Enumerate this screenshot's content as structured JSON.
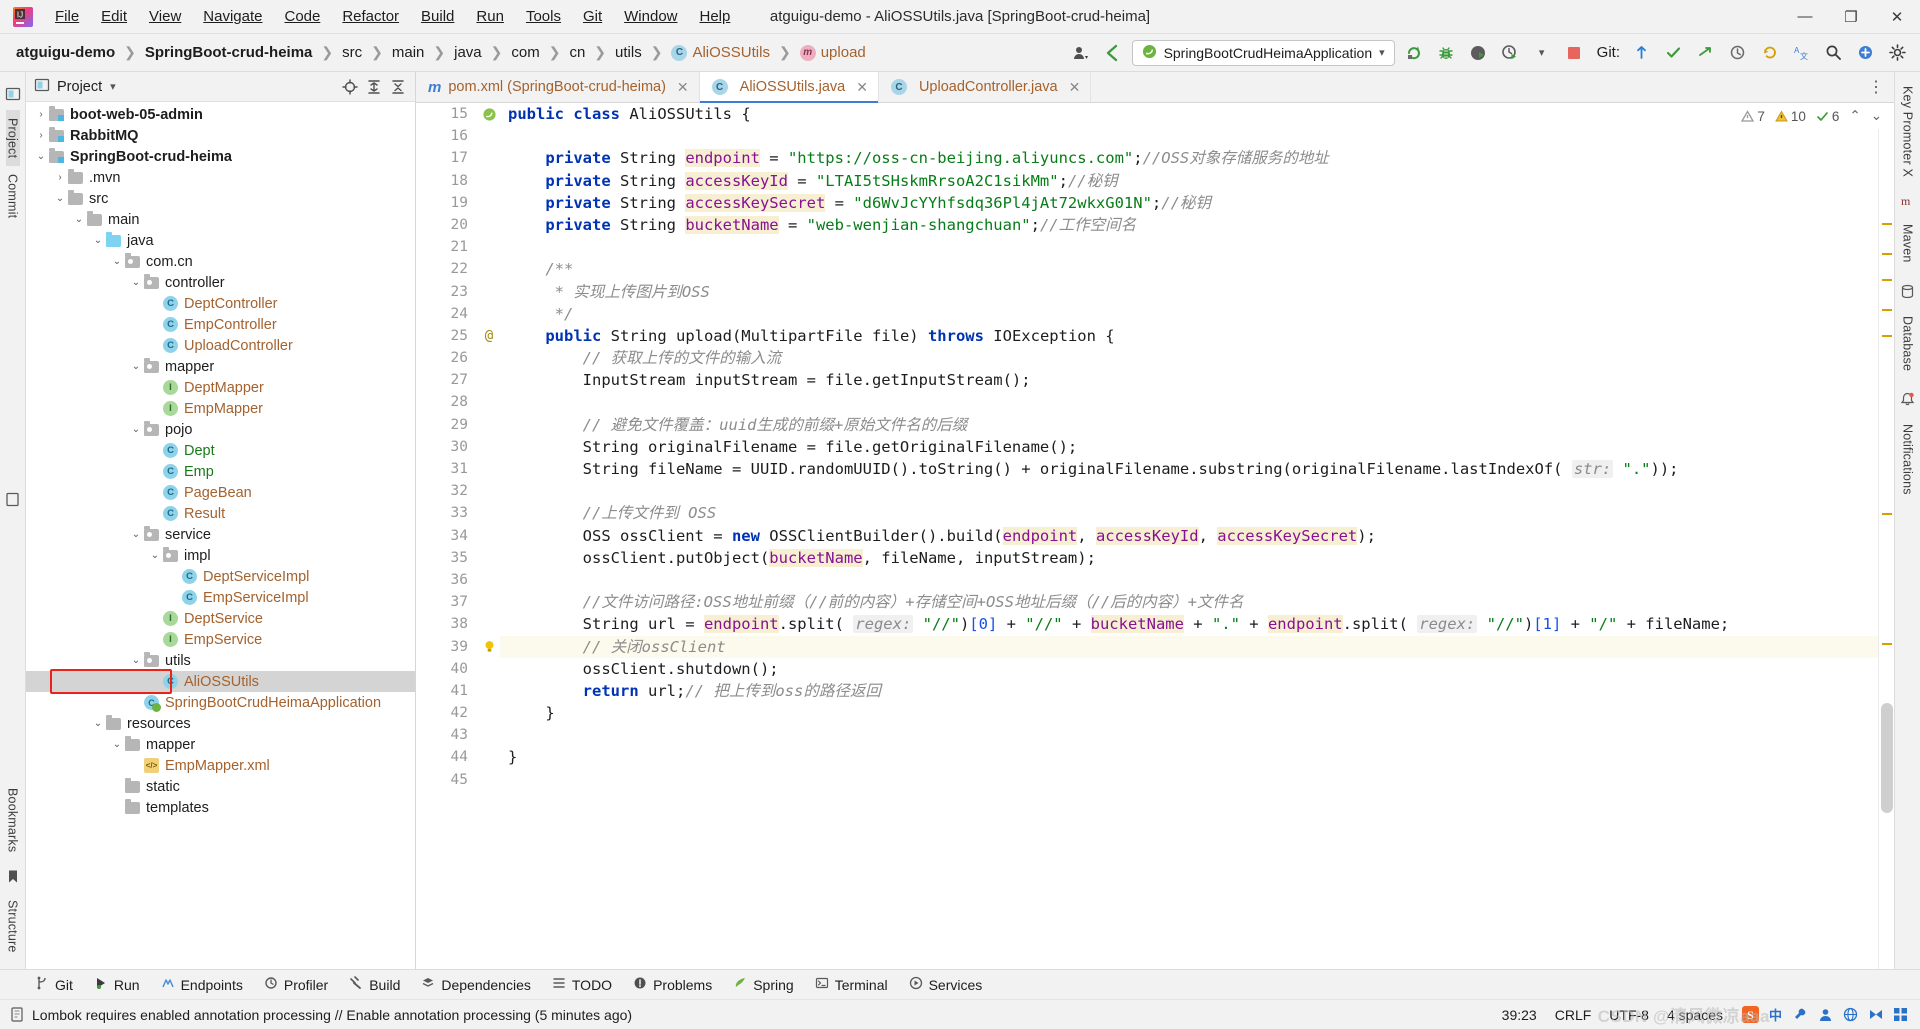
{
  "window": {
    "title": "atguigu-demo - AliOSSUtils.java [SpringBoot-crud-heima]",
    "minimize": "—",
    "maximize": "❐",
    "close": "✕"
  },
  "menu": [
    {
      "label": "File"
    },
    {
      "label": "Edit"
    },
    {
      "label": "View"
    },
    {
      "label": "Navigate"
    },
    {
      "label": "Code"
    },
    {
      "label": "Refactor"
    },
    {
      "label": "Build"
    },
    {
      "label": "Run"
    },
    {
      "label": "Tools"
    },
    {
      "label": "Git"
    },
    {
      "label": "Window"
    },
    {
      "label": "Help"
    }
  ],
  "breadcrumbs": [
    {
      "label": "atguigu-demo",
      "style": "bold"
    },
    {
      "label": "SpringBoot-crud-heima",
      "style": "bold"
    },
    {
      "label": "src",
      "style": "plain"
    },
    {
      "label": "main",
      "style": "plain"
    },
    {
      "label": "java",
      "style": "plain"
    },
    {
      "label": "com",
      "style": "plain"
    },
    {
      "label": "cn",
      "style": "plain"
    },
    {
      "label": "utils",
      "style": "plain"
    },
    {
      "label": "AliOSSUtils",
      "style": "class",
      "icon": "class-c-icon"
    },
    {
      "label": "upload",
      "style": "method",
      "icon": "method-m-icon"
    }
  ],
  "toolbar": {
    "run_config": "SpringBootCrudHeimaApplication",
    "run_config_icon": "spring-boot-icon",
    "dropdown_arrow": "▾",
    "icons": {
      "user_avatar": "user-avatar-icon",
      "back_arrow": "back-arrow-icon",
      "rerun": "rerun-icon",
      "debug": "debug-bug-icon",
      "coverage": "run-with-coverage-icon",
      "profiler": "profiler-icon",
      "stop": "stop-icon",
      "git_update": "git-update-icon",
      "git_commit": "git-commit-icon",
      "git_push": "git-push-icon",
      "git_history": "git-history-icon",
      "git_rollback": "git-rollback-icon",
      "translate": "translate-icon",
      "search": "search-icon",
      "plugins": "plugins-icon",
      "settings": "settings-gear-icon"
    },
    "git_label": "Git:"
  },
  "left_rail": [
    {
      "label": "Project",
      "selected": true
    },
    {
      "label": "Commit",
      "selected": false
    },
    {
      "label": "Bookmarks",
      "selected": false
    },
    {
      "label": "Structure",
      "selected": false
    }
  ],
  "right_rail": [
    {
      "label": "Key Promoter X"
    },
    {
      "label": "Maven"
    },
    {
      "label": "Database"
    },
    {
      "label": "Notifications"
    }
  ],
  "project_panel": {
    "title": "Project",
    "dropdown": "▾",
    "icons": {
      "locate": "locate-file-icon",
      "expand": "expand-all-icon",
      "collapse": "collapse-all-icon",
      "settings": "panel-settings-icon",
      "hide": "hide-panel-icon"
    },
    "tree": [
      {
        "indent": 1,
        "arrow": "collapsed",
        "icon": "module-folder",
        "label": "boot-web-05-admin",
        "style": "bold"
      },
      {
        "indent": 1,
        "arrow": "collapsed",
        "icon": "module-folder",
        "label": "RabbitMQ",
        "style": "bold"
      },
      {
        "indent": 1,
        "arrow": "expanded",
        "icon": "module-folder",
        "label": "SpringBoot-crud-heima",
        "style": "bold"
      },
      {
        "indent": 2,
        "arrow": "collapsed",
        "icon": "folder",
        "label": ".mvn",
        "style": "plain"
      },
      {
        "indent": 2,
        "arrow": "expanded",
        "icon": "folder",
        "label": "src",
        "style": "plain"
      },
      {
        "indent": 3,
        "arrow": "expanded",
        "icon": "folder",
        "label": "main",
        "style": "plain"
      },
      {
        "indent": 4,
        "arrow": "expanded",
        "icon": "source-folder",
        "label": "java",
        "style": "plain"
      },
      {
        "indent": 5,
        "arrow": "expanded",
        "icon": "package",
        "label": "com.cn",
        "style": "plain"
      },
      {
        "indent": 6,
        "arrow": "expanded",
        "icon": "package",
        "label": "controller",
        "style": "plain"
      },
      {
        "indent": 7,
        "arrow": "none",
        "icon": "class",
        "label": "DeptController",
        "style": "class"
      },
      {
        "indent": 7,
        "arrow": "none",
        "icon": "class",
        "label": "EmpController",
        "style": "class"
      },
      {
        "indent": 7,
        "arrow": "none",
        "icon": "class",
        "label": "UploadController",
        "style": "class"
      },
      {
        "indent": 6,
        "arrow": "expanded",
        "icon": "package",
        "label": "mapper",
        "style": "plain"
      },
      {
        "indent": 7,
        "arrow": "none",
        "icon": "interface",
        "label": "DeptMapper",
        "style": "class"
      },
      {
        "indent": 7,
        "arrow": "none",
        "icon": "interface",
        "label": "EmpMapper",
        "style": "class"
      },
      {
        "indent": 6,
        "arrow": "expanded",
        "icon": "package",
        "label": "pojo",
        "style": "plain"
      },
      {
        "indent": 7,
        "arrow": "none",
        "icon": "class",
        "label": "Dept",
        "style": "green"
      },
      {
        "indent": 7,
        "arrow": "none",
        "icon": "class",
        "label": "Emp",
        "style": "green"
      },
      {
        "indent": 7,
        "arrow": "none",
        "icon": "class",
        "label": "PageBean",
        "style": "class"
      },
      {
        "indent": 7,
        "arrow": "none",
        "icon": "class",
        "label": "Result",
        "style": "class"
      },
      {
        "indent": 6,
        "arrow": "expanded",
        "icon": "package",
        "label": "service",
        "style": "plain"
      },
      {
        "indent": 7,
        "arrow": "expanded",
        "icon": "package",
        "label": "impl",
        "style": "plain"
      },
      {
        "indent": 8,
        "arrow": "none",
        "icon": "class",
        "label": "DeptServiceImpl",
        "style": "class"
      },
      {
        "indent": 8,
        "arrow": "none",
        "icon": "class",
        "label": "EmpServiceImpl",
        "style": "class"
      },
      {
        "indent": 7,
        "arrow": "none",
        "icon": "interface",
        "label": "DeptService",
        "style": "class"
      },
      {
        "indent": 7,
        "arrow": "none",
        "icon": "interface",
        "label": "EmpService",
        "style": "class"
      },
      {
        "indent": 6,
        "arrow": "expanded",
        "icon": "package",
        "label": "utils",
        "style": "plain"
      },
      {
        "indent": 7,
        "arrow": "none",
        "icon": "class",
        "label": "AliOSSUtils",
        "style": "class",
        "selected": true,
        "highlight": true
      },
      {
        "indent": 6,
        "arrow": "none",
        "icon": "spring-class",
        "label": "SpringBootCrudHeimaApplication",
        "style": "class"
      },
      {
        "indent": 4,
        "arrow": "expanded",
        "icon": "resource-folder",
        "label": "resources",
        "style": "plain"
      },
      {
        "indent": 5,
        "arrow": "expanded",
        "icon": "folder",
        "label": "mapper",
        "style": "plain"
      },
      {
        "indent": 6,
        "arrow": "none",
        "icon": "xml",
        "label": "EmpMapper.xml",
        "style": "class"
      },
      {
        "indent": 5,
        "arrow": "none",
        "icon": "folder",
        "label": "static",
        "style": "plain"
      },
      {
        "indent": 5,
        "arrow": "none",
        "icon": "folder",
        "label": "templates",
        "style": "plain"
      }
    ]
  },
  "editor": {
    "tabs": [
      {
        "label": "pom.xml (SpringBoot-crud-heima)",
        "icon": "maven-m-icon",
        "active": false,
        "close": "✕"
      },
      {
        "label": "AliOSSUtils.java",
        "icon": "class-c-icon",
        "active": true,
        "close": "✕"
      },
      {
        "label": "UploadController.java",
        "icon": "class-c-icon",
        "active": false,
        "close": "✕"
      }
    ],
    "inspections": {
      "warnings_gray": "7",
      "warnings_yellow": "10",
      "weak_green": "6",
      "chevron_up": "⌃",
      "chevron_down": "⌄"
    },
    "first_line_number": 15,
    "lines": [
      {
        "n": 15,
        "text": "public class AliOSSUtils {",
        "gutter": "spring-bean-icon"
      },
      {
        "n": 16,
        "text": ""
      },
      {
        "n": 17,
        "text": "    private String endpoint = \"https://oss-cn-beijing.aliyuncs.com\";//OSS对象存储服务的地址"
      },
      {
        "n": 18,
        "text": "    private String accessKeyId = \"LTAI5tSHskmRrsoA2C1sikMm\";//秘钥"
      },
      {
        "n": 19,
        "text": "    private String accessKeySecret = \"d6WvJcYYhfsdq36Pl4jAt72wkxG01N\";//秘钥"
      },
      {
        "n": 20,
        "text": "    private String bucketName = \"web-wenjian-shangchuan\";//工作空间名"
      },
      {
        "n": 21,
        "text": ""
      },
      {
        "n": 22,
        "text": "    /**"
      },
      {
        "n": 23,
        "text": "     * 实现上传图片到OSS"
      },
      {
        "n": 24,
        "text": "     */"
      },
      {
        "n": 25,
        "text": "    public String upload(MultipartFile file) throws IOException {",
        "gutter": "override-at-icon"
      },
      {
        "n": 26,
        "text": "        // 获取上传的文件的输入流"
      },
      {
        "n": 27,
        "text": "        InputStream inputStream = file.getInputStream();"
      },
      {
        "n": 28,
        "text": ""
      },
      {
        "n": 29,
        "text": "        // 避免文件覆盖：uuid生成的前缀+原始文件名的后缀"
      },
      {
        "n": 30,
        "text": "        String originalFilename = file.getOriginalFilename();"
      },
      {
        "n": 31,
        "text": "        String fileName = UUID.randomUUID().toString() + originalFilename.substring(originalFilename.lastIndexOf( str: \".\"));"
      },
      {
        "n": 32,
        "text": ""
      },
      {
        "n": 33,
        "text": "        //上传文件到 OSS"
      },
      {
        "n": 34,
        "text": "        OSS ossClient = new OSSClientBuilder().build(endpoint, accessKeyId, accessKeySecret);"
      },
      {
        "n": 35,
        "text": "        ossClient.putObject(bucketName, fileName, inputStream);"
      },
      {
        "n": 36,
        "text": ""
      },
      {
        "n": 37,
        "text": "        //文件访问路径:OSS地址前缀（//前的内容）+存储空间+OSS地址后缀（//后的内容）+文件名"
      },
      {
        "n": 38,
        "text": "        String url = endpoint.split( regex: \"//\")[0] + \"//\" + bucketName + \".\" + endpoint.split( regex: \"//\")[1] + \"/\" + fileName;"
      },
      {
        "n": 39,
        "text": "        // 关闭ossClient",
        "gutter": "bulb-icon",
        "highlight": true
      },
      {
        "n": 40,
        "text": "        ossClient.shutdown();"
      },
      {
        "n": 41,
        "text": "        return url;// 把上传到oss的路径返回"
      },
      {
        "n": 42,
        "text": "    }"
      },
      {
        "n": 43,
        "text": ""
      },
      {
        "n": 44,
        "text": "}"
      },
      {
        "n": 45,
        "text": ""
      }
    ]
  },
  "tool_windows": [
    {
      "label": "Git",
      "icon": "git-branch-icon"
    },
    {
      "label": "Run",
      "icon": "run-play-icon"
    },
    {
      "label": "Endpoints",
      "icon": "endpoints-icon"
    },
    {
      "label": "Profiler",
      "icon": "profiler-icon"
    },
    {
      "label": "Build",
      "icon": "build-hammer-icon"
    },
    {
      "label": "Dependencies",
      "icon": "dependencies-icon"
    },
    {
      "label": "TODO",
      "icon": "todo-list-icon"
    },
    {
      "label": "Problems",
      "icon": "problems-icon"
    },
    {
      "label": "Spring",
      "icon": "spring-leaf-icon"
    },
    {
      "label": "Terminal",
      "icon": "terminal-icon"
    },
    {
      "label": "Services",
      "icon": "services-icon"
    }
  ],
  "status_bar": {
    "message_icon": "event-log-icon",
    "message": "Lombok requires enabled annotation processing // Enable annotation processing (5 minutes ago)",
    "caret_position": "39:23",
    "line_separator": "CRLF",
    "encoding": "UTF-8",
    "indent": "4 spaces",
    "tray_icons": [
      "sogou-input-icon",
      "ime-chinese-icon",
      "ime-tool-icon",
      "user-icon",
      "globe-icon",
      "bow-icon",
      "apps-icon"
    ],
    "watermark": "CSDN @清风微凉aaa"
  },
  "colors": {
    "accent_blue": "#3d7dd2",
    "selection_gray": "#d4d4d4",
    "highlight_red": "#e8231a",
    "string_green": "#067d17",
    "keyword_blue": "#0033b3",
    "field_purple": "#871094",
    "comment_gray": "#8c8c8c",
    "panel_bg": "#f2f2f2",
    "editor_bg": "#ffffff",
    "current_line": "#fcfaed"
  }
}
